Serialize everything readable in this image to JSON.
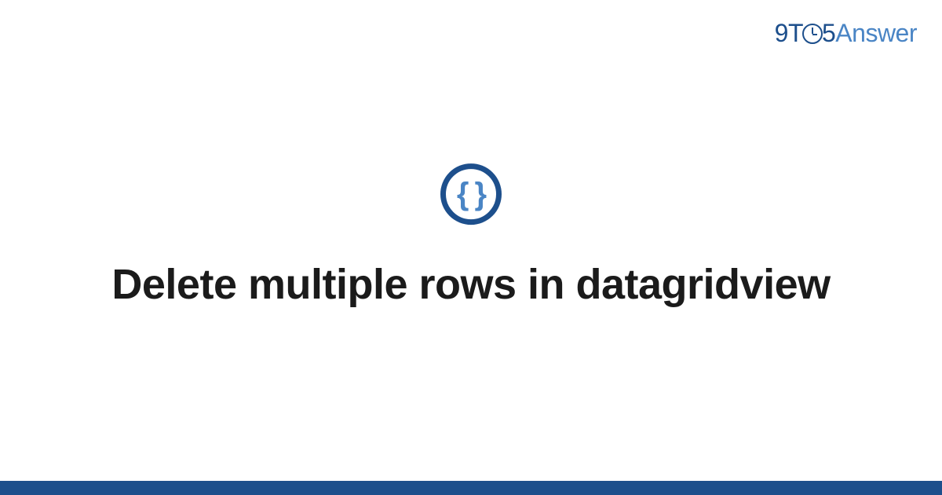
{
  "logo": {
    "part1": "9T",
    "part2": "5",
    "part3": "Answer"
  },
  "icon": {
    "braces": "{ }"
  },
  "title": "Delete multiple rows in datagridview",
  "colors": {
    "primary": "#1d4f8c",
    "secondary": "#4a85c5",
    "text": "#1b1b1b"
  }
}
